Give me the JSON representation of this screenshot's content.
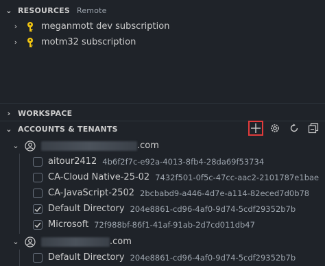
{
  "resources": {
    "title": "RESOURCES",
    "subtitle": "Remote",
    "items": [
      {
        "label": "meganmott dev subscription",
        "icon": "key-icon"
      },
      {
        "label": "motm32 subscription",
        "icon": "key-icon"
      }
    ]
  },
  "workspace": {
    "title": "WORKSPACE"
  },
  "accounts": {
    "title": "ACCOUNTS & TENANTS",
    "toolbar": [
      {
        "name": "add-icon",
        "highlighted": true
      },
      {
        "name": "gear-icon"
      },
      {
        "name": "refresh-icon"
      },
      {
        "name": "collapse-all-icon"
      }
    ],
    "account_list": [
      {
        "email_suffix": ".com",
        "tenants": [
          {
            "name": "aitour2412",
            "id": "4b6f2f7c-e92a-4013-8fb4-28da69f53734",
            "checked": false
          },
          {
            "name": "CA-Cloud Native-25-02",
            "id": "7432f501-0f5c-47cc-aac2-2101787e1bae",
            "checked": false
          },
          {
            "name": "CA-JavaScript-2502",
            "id": "2bcbabd9-a446-4d7e-a114-82eced7d0b78",
            "checked": false
          },
          {
            "name": "Default Directory",
            "id": "204e8861-cd96-4af0-9d74-5cdf29352b7b",
            "checked": true
          },
          {
            "name": "Microsoft",
            "id": "72f988bf-86f1-41af-91ab-2d7cd011db47",
            "checked": true
          }
        ]
      },
      {
        "email_suffix": ".com",
        "tenants": [
          {
            "name": "Default Directory",
            "id": "204e8861-cd96-4af0-9d74-5cdf29352b7b",
            "checked": false
          }
        ]
      }
    ]
  },
  "colors": {
    "highlight": "#e23b3b",
    "key": "#f2c511",
    "background": "#1f2329"
  }
}
